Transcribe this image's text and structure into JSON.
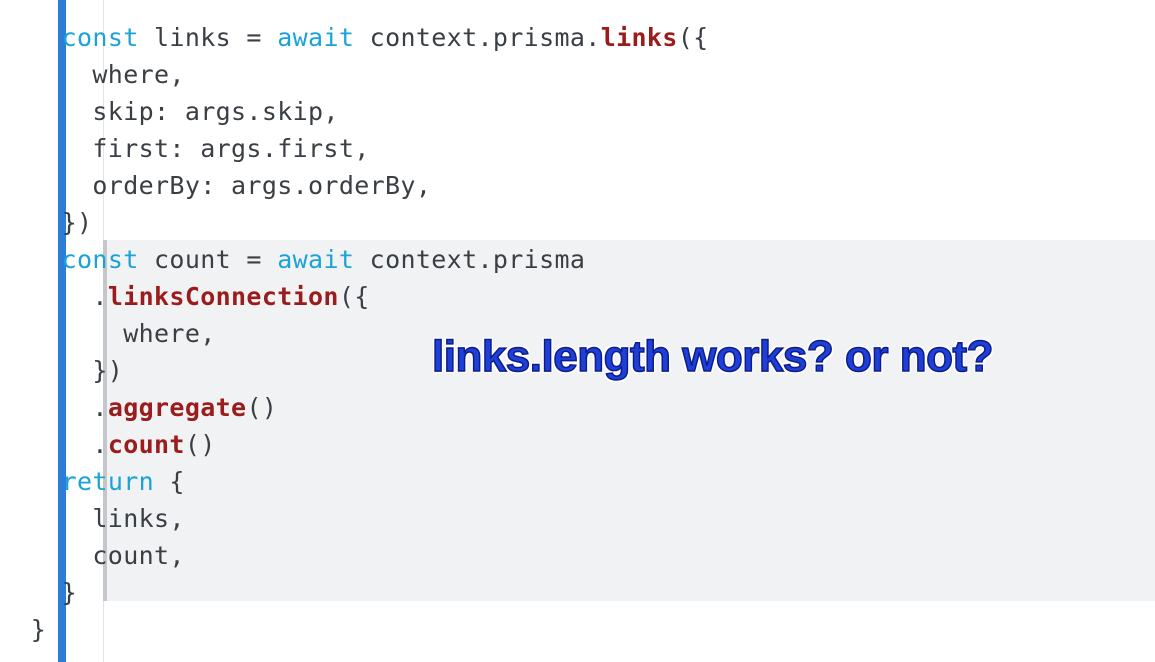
{
  "colors": {
    "accent_bar": "#2b7dd6",
    "keyword": "#1aa3d6",
    "method": "#9a1c1c",
    "text": "#3a3f45",
    "highlight_background": "#f1f2f4",
    "annotation": "#1f3fd6"
  },
  "code": {
    "lines": [
      {
        "segments": [
          {
            "text": "    "
          },
          {
            "text": "const",
            "kind": "kw"
          },
          {
            "text": " links = "
          },
          {
            "text": "await",
            "kind": "kw"
          },
          {
            "text": " context.prisma."
          },
          {
            "text": "links",
            "kind": "fn"
          },
          {
            "text": "({"
          }
        ]
      },
      {
        "segments": [
          {
            "text": "      where,"
          }
        ]
      },
      {
        "segments": [
          {
            "text": "      skip: args.skip,"
          }
        ]
      },
      {
        "segments": [
          {
            "text": "      first: args.first,"
          }
        ]
      },
      {
        "segments": [
          {
            "text": "      orderBy: args.orderBy,"
          }
        ]
      },
      {
        "segments": [
          {
            "text": "    })"
          }
        ]
      },
      {
        "segments": [
          {
            "text": "    "
          },
          {
            "text": "const",
            "kind": "kw"
          },
          {
            "text": " count = "
          },
          {
            "text": "await",
            "kind": "kw"
          },
          {
            "text": " context.prisma"
          }
        ]
      },
      {
        "segments": [
          {
            "text": "      ."
          },
          {
            "text": "linksConnection",
            "kind": "fn"
          },
          {
            "text": "({"
          }
        ]
      },
      {
        "segments": [
          {
            "text": "        where,"
          }
        ]
      },
      {
        "segments": [
          {
            "text": "      })"
          }
        ]
      },
      {
        "segments": [
          {
            "text": "      ."
          },
          {
            "text": "aggregate",
            "kind": "fn"
          },
          {
            "text": "()"
          }
        ]
      },
      {
        "segments": [
          {
            "text": "      ."
          },
          {
            "text": "count",
            "kind": "fn"
          },
          {
            "text": "()"
          }
        ]
      },
      {
        "segments": [
          {
            "text": "    "
          },
          {
            "text": "return",
            "kind": "kw"
          },
          {
            "text": " {"
          }
        ]
      },
      {
        "segments": [
          {
            "text": "      links,"
          }
        ]
      },
      {
        "segments": [
          {
            "text": "      count,"
          }
        ]
      },
      {
        "segments": [
          {
            "text": "    }"
          }
        ]
      },
      {
        "segments": [
          {
            "text": "  }"
          }
        ]
      }
    ]
  },
  "annotation": {
    "text": "links.length works? or not?"
  }
}
